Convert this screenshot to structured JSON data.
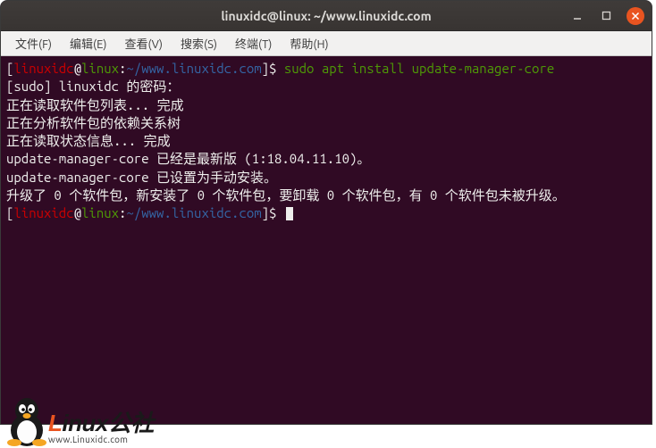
{
  "titlebar": {
    "title": "linuxidc@linux: ~/www.linuxidc.com"
  },
  "menubar": {
    "items": [
      "文件(F)",
      "编辑(E)",
      "查看(V)",
      "搜索(S)",
      "终端(T)",
      "帮助(H)"
    ]
  },
  "prompt": {
    "user": "linuxidc",
    "at": "@",
    "host": "linux",
    "colon": ":",
    "path": "~/www.linuxidc.com",
    "end": "$ "
  },
  "terminal": {
    "cmd1": "sudo apt install update-manager-core",
    "line1": "[sudo] linuxidc 的密码：",
    "line2": "正在读取软件包列表... 完成",
    "line3": "正在分析软件包的依赖关系树",
    "line4": "正在读取状态信息... 完成",
    "line5": "update-manager-core 已经是最新版 (1:18.04.11.10)。",
    "line6": "update-manager-core 已设置为手动安装。",
    "line7": "升级了 0 个软件包，新安装了 0 个软件包，要卸载 0 个软件包，有 0 个软件包未被升级。"
  },
  "watermark": {
    "letter_l": "L",
    "letters_inux": "inux",
    "suffix": "公社",
    "url": "www.Linuxidc.com"
  }
}
